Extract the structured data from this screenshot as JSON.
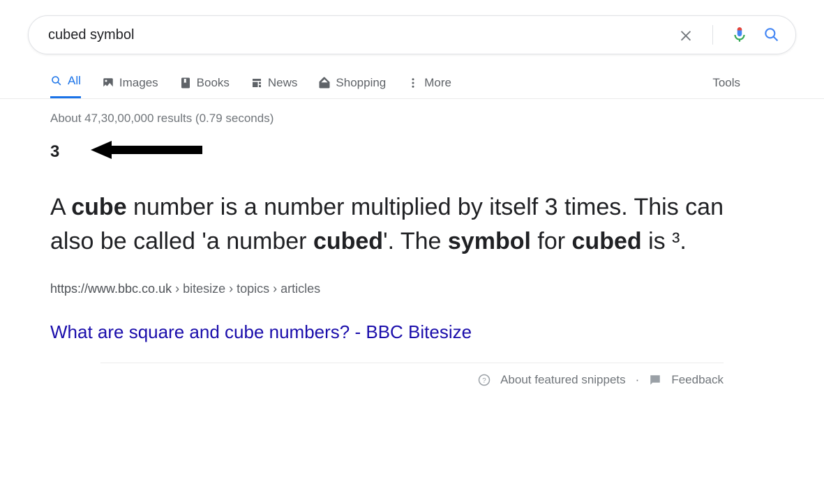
{
  "search": {
    "query": "cubed symbol"
  },
  "tabs": {
    "all": "All",
    "images": "Images",
    "books": "Books",
    "news": "News",
    "shopping": "Shopping",
    "more": "More",
    "tools": "Tools"
  },
  "stats": "About 47,30,00,000 results (0.79 seconds)",
  "answer": {
    "heading_value": "3",
    "snippet_parts": {
      "p1": "A ",
      "b1": "cube",
      "p2": " number is a number multiplied by itself 3 times. This can also be called 'a number ",
      "b2": "cubed",
      "p3": "'. The ",
      "b3": "symbol",
      "p4": " for ",
      "b4": "cubed",
      "p5": " is ³."
    }
  },
  "result": {
    "url_host": "https://www.bbc.co.uk",
    "url_crumbs": " › bitesize › topics › articles",
    "title": "What are square and cube numbers? - BBC Bitesize"
  },
  "footer": {
    "about": "About featured snippets",
    "separator": "·",
    "feedback": "Feedback"
  }
}
